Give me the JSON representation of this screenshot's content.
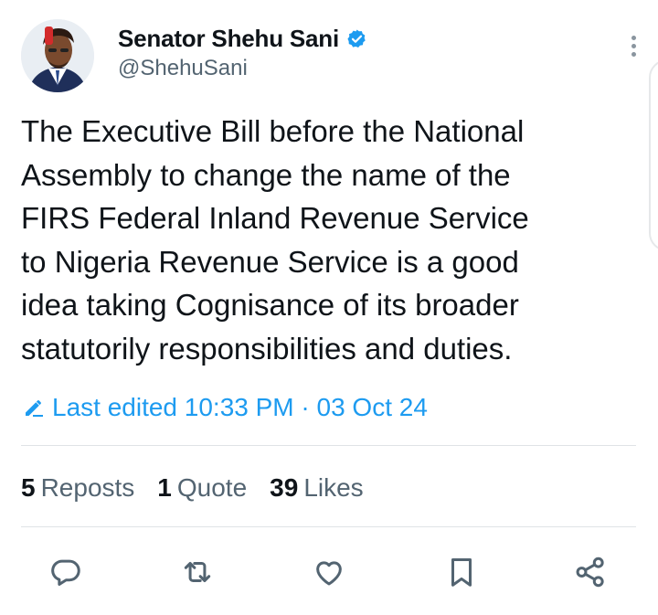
{
  "author": {
    "display_name": "Senator Shehu Sani",
    "handle": "@ShehuSani",
    "verified_color": "#1d9bf0"
  },
  "tweet": {
    "text": "The Executive Bill before the National\nAssembly to change the name of the\nFIRS Federal Inland Revenue Service\nto Nigeria Revenue Service is a good\nidea taking Cognisance of its broader\nstatutorily responsibilities and duties.",
    "edited_label": "Last edited 10:33 PM · 03 Oct 24"
  },
  "stats": {
    "reposts": {
      "count": "5",
      "label": "Reposts"
    },
    "quotes": {
      "count": "1",
      "label": "Quote"
    },
    "likes": {
      "count": "39",
      "label": "Likes"
    }
  },
  "actions": [
    {
      "icon": "reply-icon"
    },
    {
      "icon": "repost-icon"
    },
    {
      "icon": "like-icon"
    },
    {
      "icon": "bookmark-icon"
    },
    {
      "icon": "share-icon"
    }
  ],
  "colors": {
    "accent": "#1d9bf0",
    "text_primary": "#0f1419",
    "text_secondary": "#536471",
    "icon_gray": "#536471",
    "divider": "#dfe3e6"
  }
}
